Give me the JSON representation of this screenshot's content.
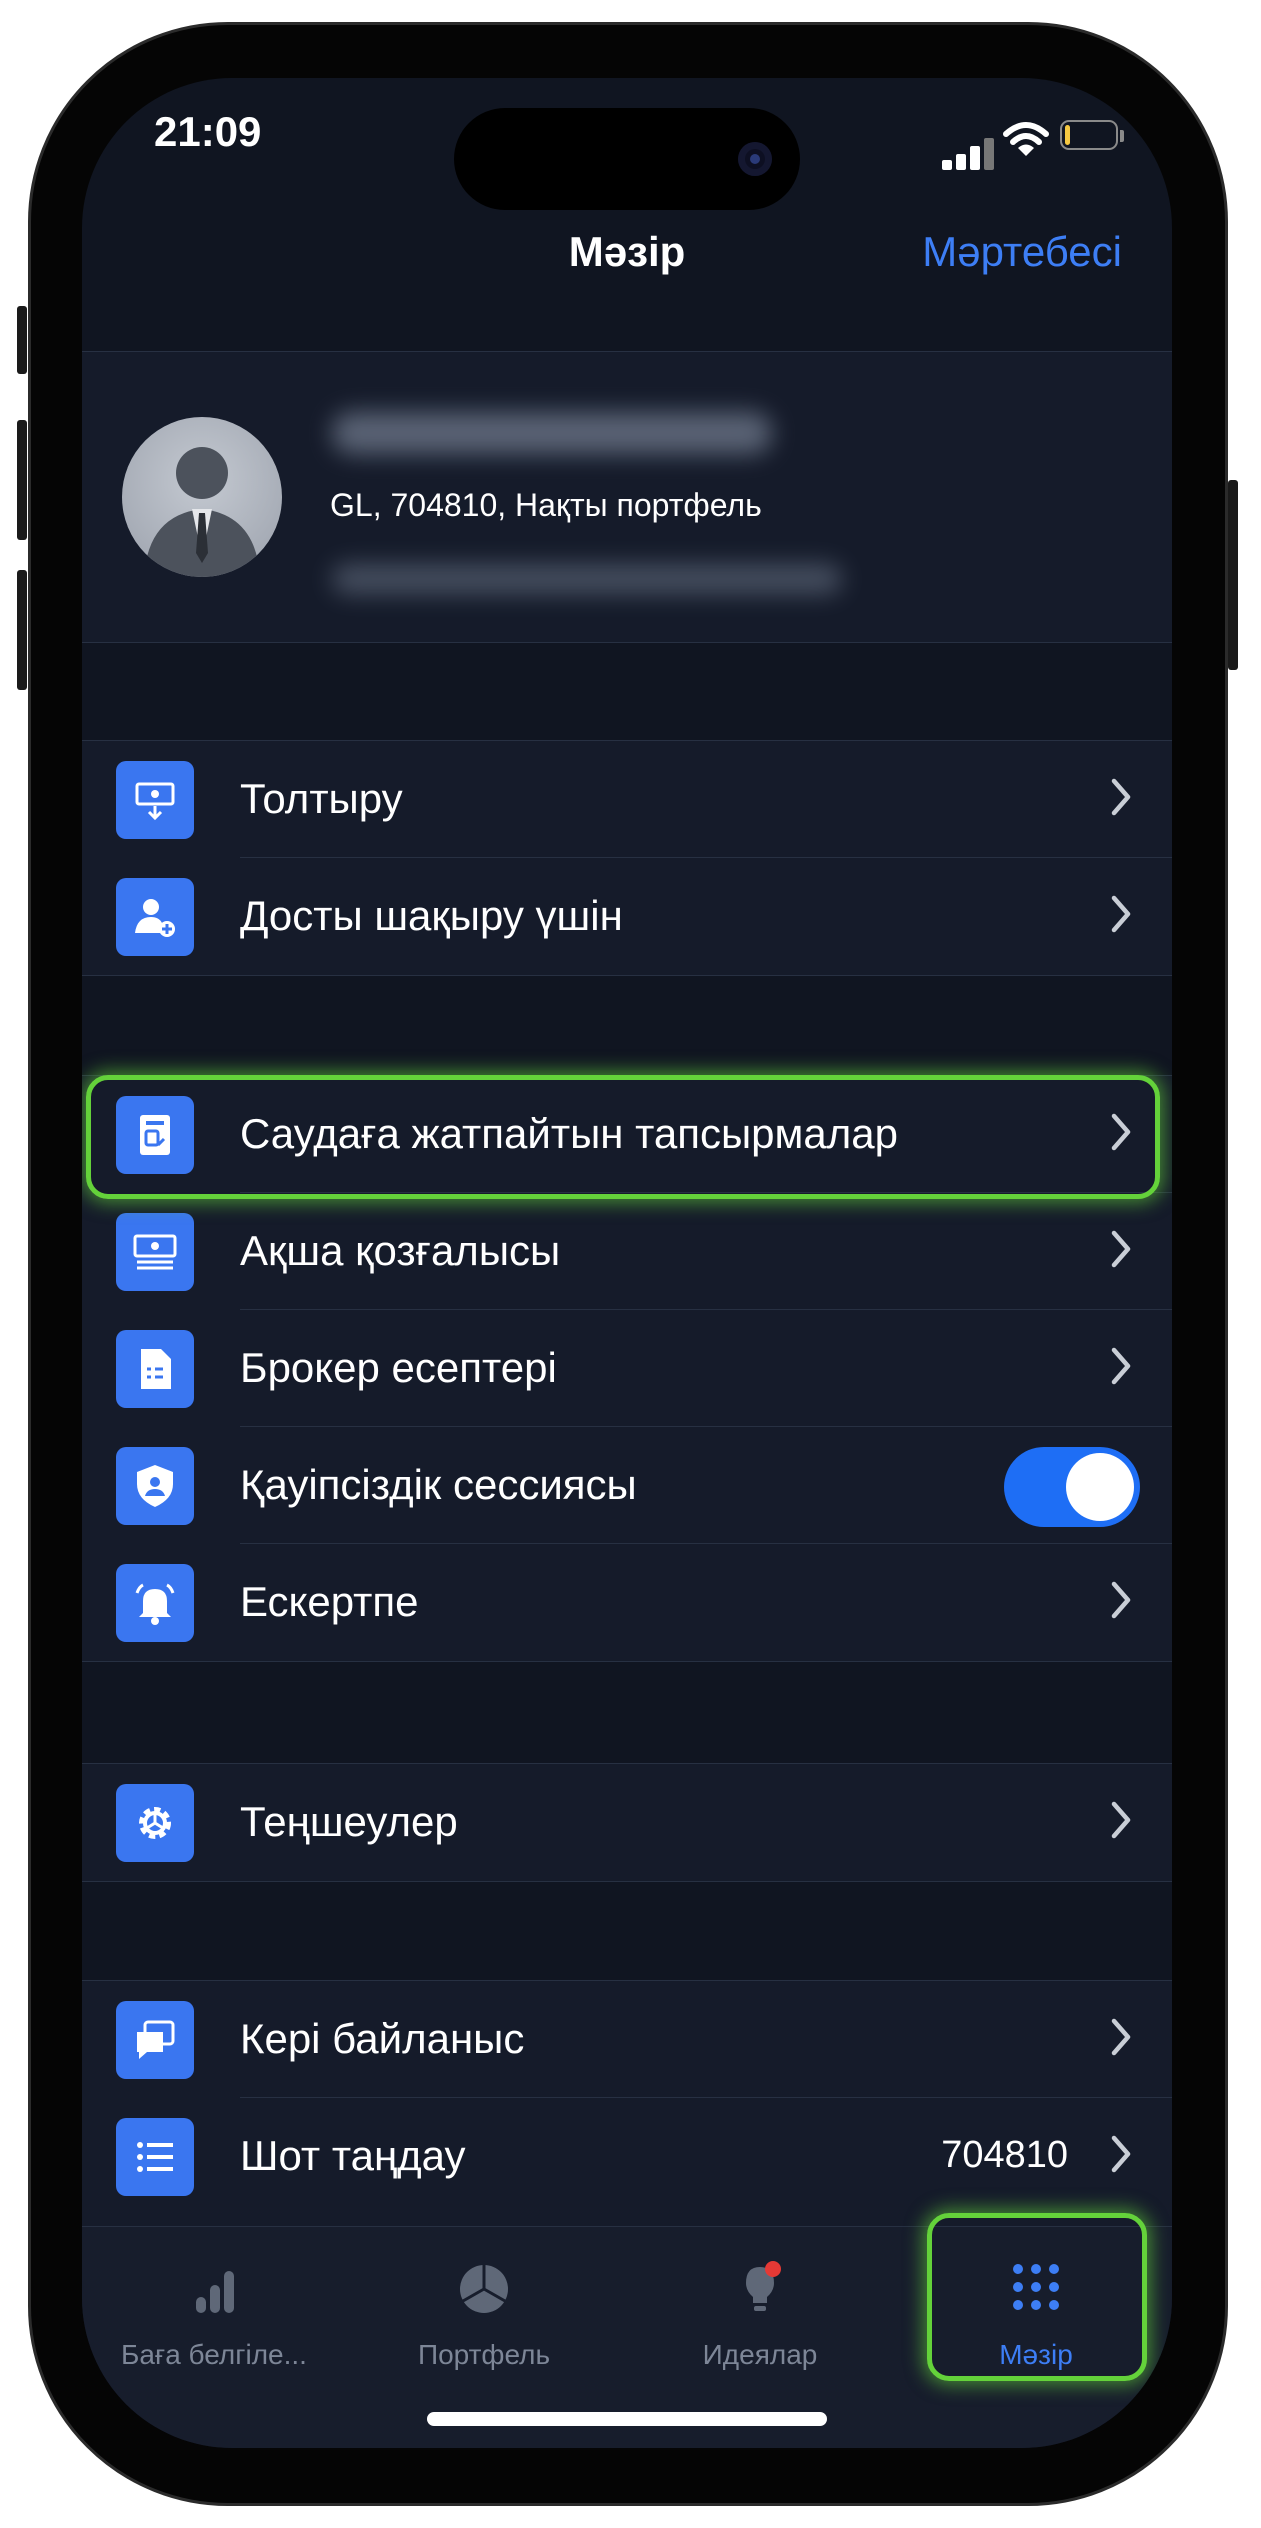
{
  "status_bar": {
    "time": "21:09",
    "battery_level": 0.1
  },
  "header": {
    "title": "Мәзір",
    "status_link": "Мәртебесі"
  },
  "profile": {
    "account_line": "GL, 704810, Нақты портфель"
  },
  "menu": {
    "group1": [
      {
        "label": "Толтыру",
        "icon": "deposit-icon"
      },
      {
        "label": "Досты шақыру үшін",
        "icon": "invite-friend-icon"
      }
    ],
    "group2": [
      {
        "label": "Саудаға жатпайтын тапсырмалар",
        "icon": "document-icon",
        "highlighted": true
      },
      {
        "label": "Ақша қозғалысы",
        "icon": "money-icon"
      },
      {
        "label": "Брокер есептері",
        "icon": "report-icon"
      },
      {
        "label": "Қауіпсіздік сессиясы",
        "icon": "shield-icon",
        "toggle": true
      },
      {
        "label": "Ескертпе",
        "icon": "bell-icon"
      }
    ],
    "group3": [
      {
        "label": "Теңшеулер",
        "icon": "gear-icon"
      }
    ],
    "group4": [
      {
        "label": "Кері байланыс",
        "icon": "chat-icon"
      },
      {
        "label": "Шот таңдау",
        "icon": "list-icon",
        "value": "704810"
      }
    ]
  },
  "tabbar": [
    {
      "label": "Баға белгіле...",
      "icon": "bar-chart-icon",
      "active": false
    },
    {
      "label": "Портфель",
      "icon": "pie-chart-icon",
      "active": false
    },
    {
      "label": "Идеялар",
      "icon": "lightbulb-icon",
      "active": false,
      "badge": true
    },
    {
      "label": "Мәзір",
      "icon": "grid-menu-icon",
      "active": true
    }
  ],
  "colors": {
    "accent": "#3d7ef5",
    "highlight": "#64d23a",
    "background": "#101521"
  }
}
